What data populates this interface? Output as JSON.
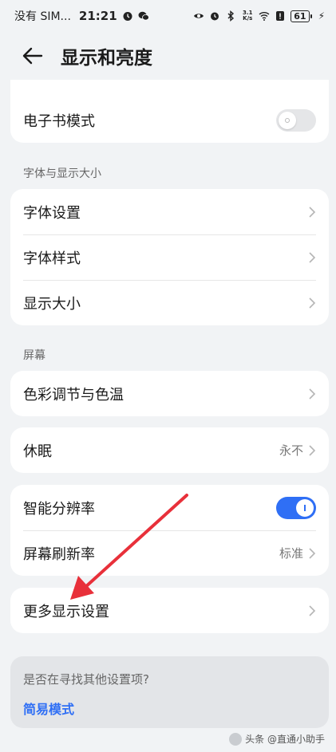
{
  "status_bar": {
    "carrier": "没有 SIM...",
    "time": "21:21",
    "network_speed": "3.1 K/s",
    "battery": "61"
  },
  "header": {
    "title": "显示和亮度"
  },
  "card_ebook": {
    "label": "电子书模式",
    "toggle_state": "off"
  },
  "section_font": {
    "title": "字体与显示大小",
    "items": [
      {
        "label": "字体设置"
      },
      {
        "label": "字体样式"
      },
      {
        "label": "显示大小"
      }
    ]
  },
  "section_screen": {
    "title": "屏幕",
    "color_item": "色彩调节与色温"
  },
  "card_sleep": {
    "label": "休眠",
    "value": "永不"
  },
  "card_resolution": {
    "smart_resolution": "智能分辨率",
    "smart_resolution_state": "on",
    "refresh_rate": "屏幕刷新率",
    "refresh_rate_value": "标准"
  },
  "card_more": {
    "label": "更多显示设置"
  },
  "suggest": {
    "question": "是否在寻找其他设置项?",
    "link": "简易模式"
  },
  "watermark": {
    "text": "头条 @直通小助手"
  },
  "colors": {
    "accent": "#2f6ff5",
    "arrow": "#e8303a",
    "background": "#f1f3f5"
  }
}
